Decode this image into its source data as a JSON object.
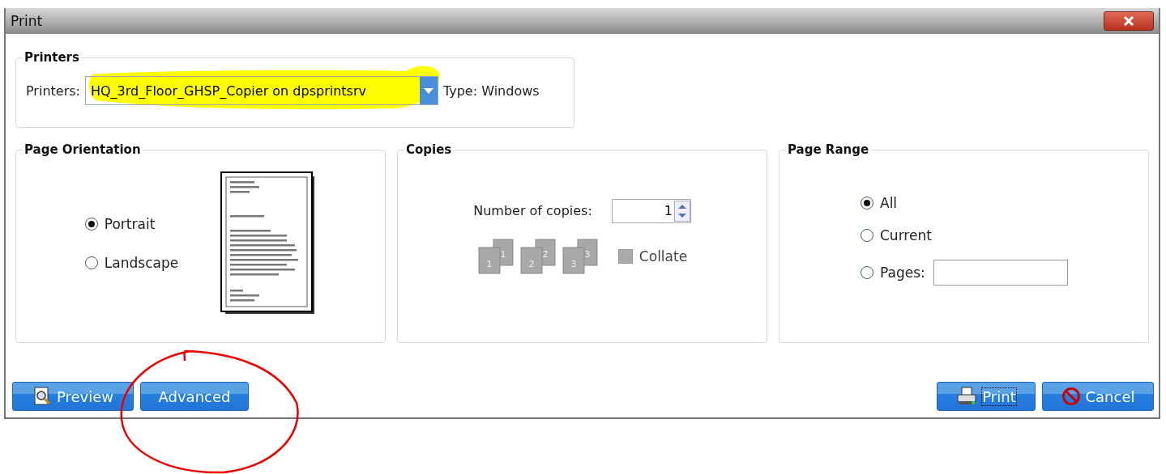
{
  "window": {
    "title": "Print"
  },
  "printers": {
    "title": "Printers",
    "label": "Printers:",
    "value": "HQ_3rd_Floor_GHSP_Copier on dpsprintsrv",
    "type_label": "Type: Windows"
  },
  "orientation": {
    "title": "Page Orientation",
    "options": [
      {
        "label": "Portrait",
        "selected": true
      },
      {
        "label": "Landscape",
        "selected": false
      }
    ]
  },
  "copies": {
    "title": "Copies",
    "label": "Number of copies:",
    "value": "1",
    "collate": {
      "label": "Collate",
      "checked": false,
      "disabled": true
    },
    "page_numbers": [
      "1",
      "1",
      "2",
      "2",
      "3",
      "3"
    ]
  },
  "page_range": {
    "title": "Page Range",
    "options": [
      {
        "label": "All",
        "selected": true
      },
      {
        "label": "Current",
        "selected": false
      },
      {
        "label": "Pages:",
        "selected": false
      }
    ]
  },
  "buttons": [
    {
      "label": "Preview",
      "kind": "preview"
    },
    {
      "label": "Advanced",
      "kind": "plain"
    },
    {
      "label": "Print",
      "kind": "print",
      "focused": true
    },
    {
      "label": "Cancel",
      "kind": "cancel"
    }
  ]
}
